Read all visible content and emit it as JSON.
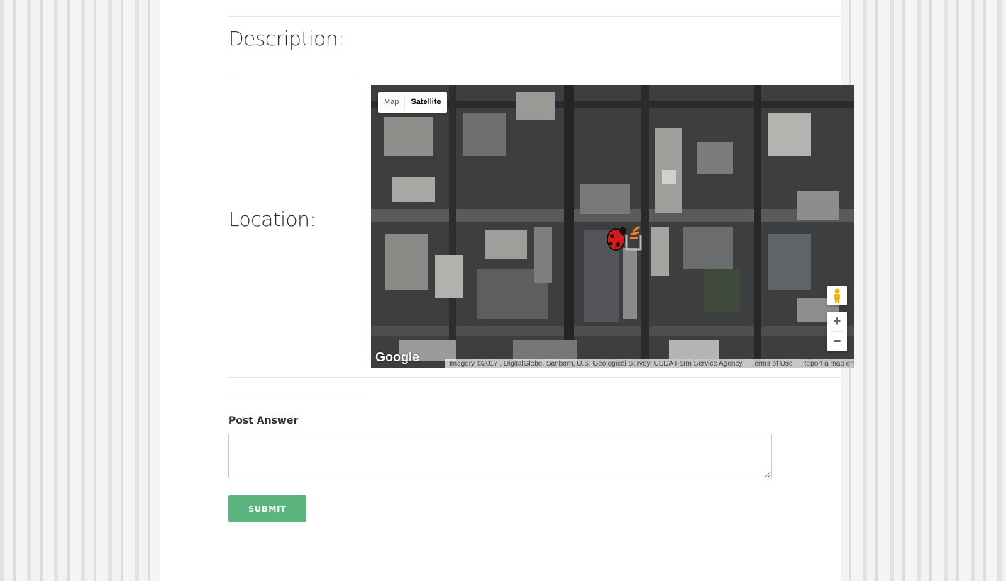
{
  "description": {
    "label": "Description:"
  },
  "location": {
    "label": "Location:"
  },
  "map": {
    "type_control": {
      "map_label": "Map",
      "satellite_label": "Satellite",
      "selected": "Satellite"
    },
    "zoom_in_label": "+",
    "zoom_out_label": "−",
    "logo_text": "Google",
    "attribution": "Imagery ©2017 , DigitalGlobe, Sanborn, U.S. Geological Survey, USDA Farm Service Agency",
    "terms_label": "Terms of Use",
    "report_label": "Report a map error",
    "marker_icon": "ladybug-marker-icon",
    "secondary_marker_icon": "stackoverflow-marker-icon"
  },
  "post_answer": {
    "label": "Post Answer",
    "textarea_value": "",
    "submit_label": "SUBMIT"
  },
  "colors": {
    "submit_button": "#5cb57c",
    "panel_background": "#ffffff",
    "page_background": "#ebebea"
  }
}
